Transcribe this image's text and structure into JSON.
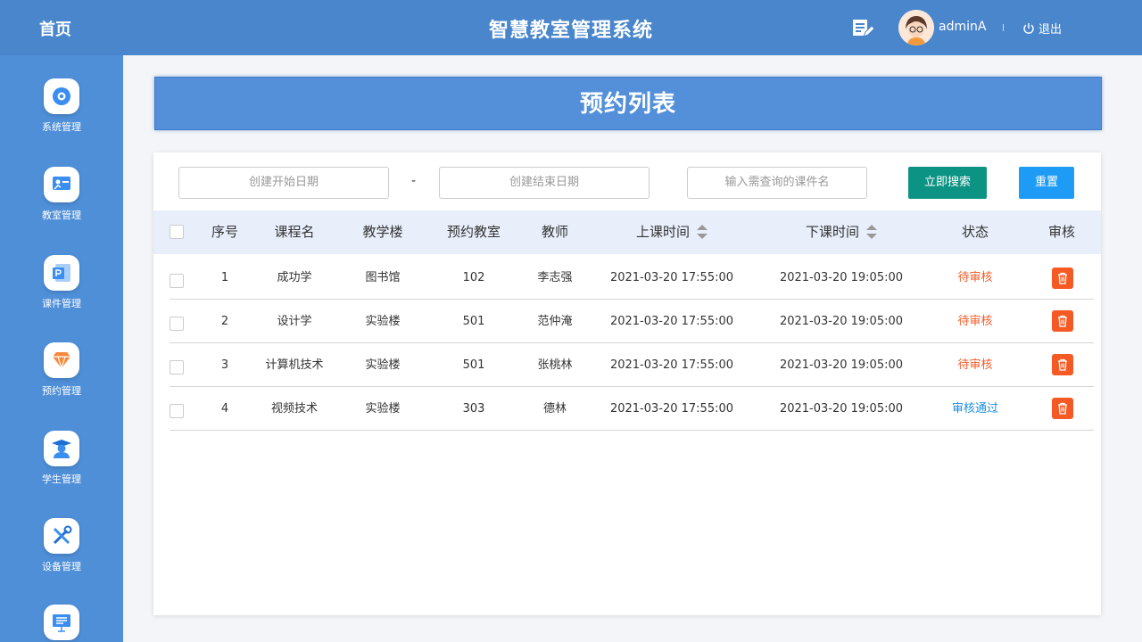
{
  "header": {
    "home": "首页",
    "title": "智慧教室管理系统",
    "username": "adminA",
    "logout": "退出"
  },
  "sidebar": {
    "items": [
      {
        "label": "系统管理",
        "icon": "gear-icon"
      },
      {
        "label": "教室管理",
        "icon": "classroom-icon"
      },
      {
        "label": "课件管理",
        "icon": "ppt-icon"
      },
      {
        "label": "预约管理",
        "icon": "diamond-icon"
      },
      {
        "label": "学生管理",
        "icon": "student-icon"
      },
      {
        "label": "设备管理",
        "icon": "tools-icon"
      },
      {
        "label": "",
        "icon": "presentation-icon"
      }
    ]
  },
  "page": {
    "title": "预约列表"
  },
  "search": {
    "start_placeholder": "创建开始日期",
    "dash": "-",
    "end_placeholder": "创建结束日期",
    "course_placeholder": "输入需查询的课件名",
    "search_btn": "立即搜索",
    "reset_btn": "重置"
  },
  "table": {
    "headers": {
      "index": "序号",
      "course": "课程名",
      "building": "教学楼",
      "room": "预约教室",
      "teacher": "教师",
      "start": "上课时间",
      "end": "下课时间",
      "status": "状态",
      "audit": "审核"
    },
    "rows": [
      {
        "index": "1",
        "course": "成功学",
        "building": "图书馆",
        "room": "102",
        "teacher": "李志强",
        "start": "2021-03-20 17:55:00",
        "end": "2021-03-20 19:05:00",
        "status": "待审核"
      },
      {
        "index": "2",
        "course": "设计学",
        "building": "实验楼",
        "room": "501",
        "teacher": "范仲淹",
        "start": "2021-03-20 17:55:00",
        "end": "2021-03-20 19:05:00",
        "status": "待审核"
      },
      {
        "index": "3",
        "course": "计算机技术",
        "building": "实验楼",
        "room": "501",
        "teacher": "张桃林",
        "start": "2021-03-20 17:55:00",
        "end": "2021-03-20 19:05:00",
        "status": "待审核"
      },
      {
        "index": "4",
        "course": "视频技术",
        "building": "实验楼",
        "room": "303",
        "teacher": "德林",
        "start": "2021-03-20 17:55:00",
        "end": "2021-03-20 19:05:00",
        "status": "审核通过"
      }
    ]
  },
  "colors": {
    "header": "#4a86cc",
    "sidebar": "#4f8fd8",
    "search_btn": "#0d9383",
    "reset_btn": "#1e9cf5",
    "pending": "#f25c28",
    "approved": "#1a8de0",
    "delete": "#f55a25"
  }
}
